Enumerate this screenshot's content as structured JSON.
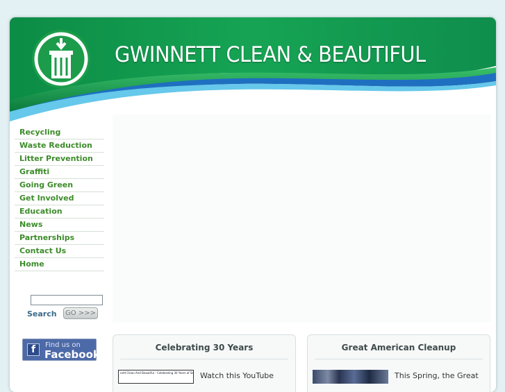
{
  "header": {
    "site_title": "GWINNETT CLEAN & BEAUTIFUL"
  },
  "sidebar": {
    "items": [
      {
        "label": "Recycling"
      },
      {
        "label": "Waste Reduction"
      },
      {
        "label": "Litter Prevention"
      },
      {
        "label": "Graffiti"
      },
      {
        "label": "Going Green"
      },
      {
        "label": "Get Involved"
      },
      {
        "label": "Education"
      },
      {
        "label": "News"
      },
      {
        "label": "Partnerships"
      },
      {
        "label": "Contact Us"
      },
      {
        "label": "Home"
      }
    ]
  },
  "search": {
    "label": "Search",
    "button_label": "GO >>>",
    "value": ""
  },
  "facebook": {
    "line1": "Find us on",
    "line2": "Facebook",
    "icon_letter": "f"
  },
  "cards": [
    {
      "title": "Celebrating 30 Years",
      "text": "Watch this YouTube",
      "thumb_text": "nett Clean And Beautiful - Celebrating 30 Years of Servic"
    },
    {
      "title": "Great American Cleanup",
      "text": "This Spring, the Great"
    }
  ],
  "colors": {
    "nav_text": "#3c8c2a",
    "brand_green": "#1a9a4a",
    "brand_blue": "#1f6fc0"
  }
}
